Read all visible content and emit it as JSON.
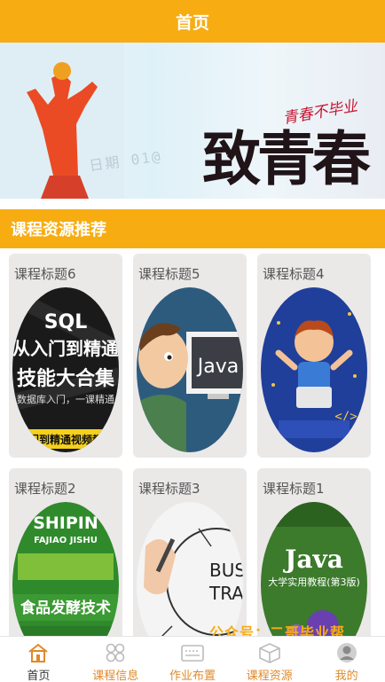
{
  "header": {
    "title": "首页"
  },
  "banner": {
    "title_text": "致青春",
    "subtitle_text": "青春不毕业",
    "ghost_text": "日期 01@"
  },
  "section": {
    "title": "课程资源推荐"
  },
  "courses": [
    {
      "title": "课程标题6",
      "image_lines": [
        "SQL",
        "从入门到精通",
        "技能大合集",
        "数据库入门，一课精通",
        "入门到精通视频教程"
      ]
    },
    {
      "title": "课程标题5",
      "image_lines": [
        "Java"
      ]
    },
    {
      "title": "课程标题4",
      "image_lines": [
        "</>"
      ]
    },
    {
      "title": "课程标题2",
      "image_lines": [
        "SHIPIN",
        "FAJIAO JISHU",
        "食品发酵技术"
      ]
    },
    {
      "title": "课程标题3",
      "image_lines": [
        "BUSI",
        "TRAI"
      ]
    },
    {
      "title": "课程标题1",
      "image_lines": [
        "Java",
        "大学实用教程(第3版)"
      ]
    }
  ],
  "watermark": "公众号：二哥毕业帮",
  "tabbar": [
    {
      "label": "首页",
      "icon": "home-icon",
      "active": true
    },
    {
      "label": "课程信息",
      "icon": "grid-icon",
      "active": false
    },
    {
      "label": "作业布置",
      "icon": "keyboard-icon",
      "active": false
    },
    {
      "label": "课程资源",
      "icon": "box-icon",
      "active": false
    },
    {
      "label": "我的",
      "icon": "user-icon",
      "active": false
    }
  ],
  "colors": {
    "accent": "#f7ac12",
    "tab_label": "#e08a2a"
  }
}
